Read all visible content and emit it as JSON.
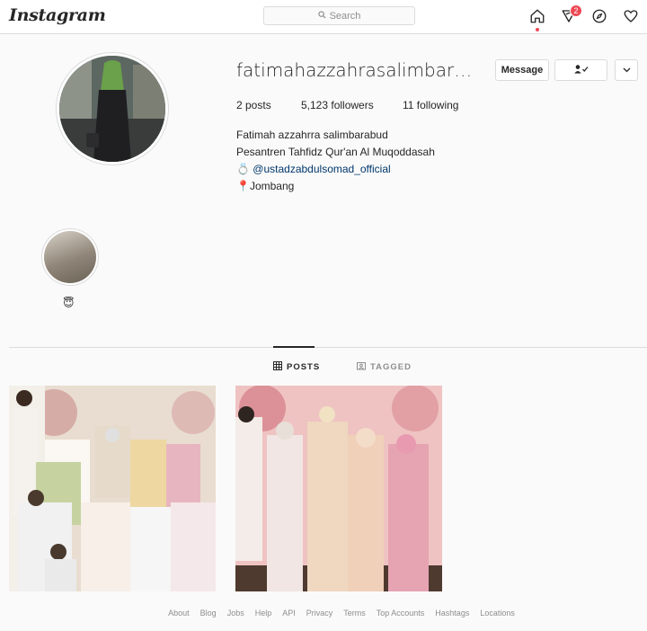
{
  "app": {
    "logo": "Instagram"
  },
  "search": {
    "label": "Search"
  },
  "nav": {
    "notification_count": "2"
  },
  "profile": {
    "username": "fatimahazzahrasalimbarabu...",
    "message_button": "Message",
    "posts": "2 posts",
    "followers": "5,123 followers",
    "following": "11 following",
    "bio": {
      "name": "Fatimah azzahrra salimbarabud",
      "line2": "Pesantren Tahfidz Qur'an Al Muqoddasah",
      "ring_emoji": "💍",
      "mention": "@ustadzabdulsomad_official",
      "pin_emoji": "📍",
      "location": "Jombang"
    }
  },
  "highlight": {
    "label": "😇"
  },
  "tabs": {
    "posts": "POSTS",
    "tagged": "TAGGED"
  },
  "footer": [
    "About",
    "Blog",
    "Jobs",
    "Help",
    "API",
    "Privacy",
    "Terms",
    "Top Accounts",
    "Hashtags",
    "Locations"
  ],
  "colors": {
    "accent": "#ed4956",
    "link": "#00376b",
    "border": "#dbdbdb",
    "muted": "#8e8e8e"
  }
}
